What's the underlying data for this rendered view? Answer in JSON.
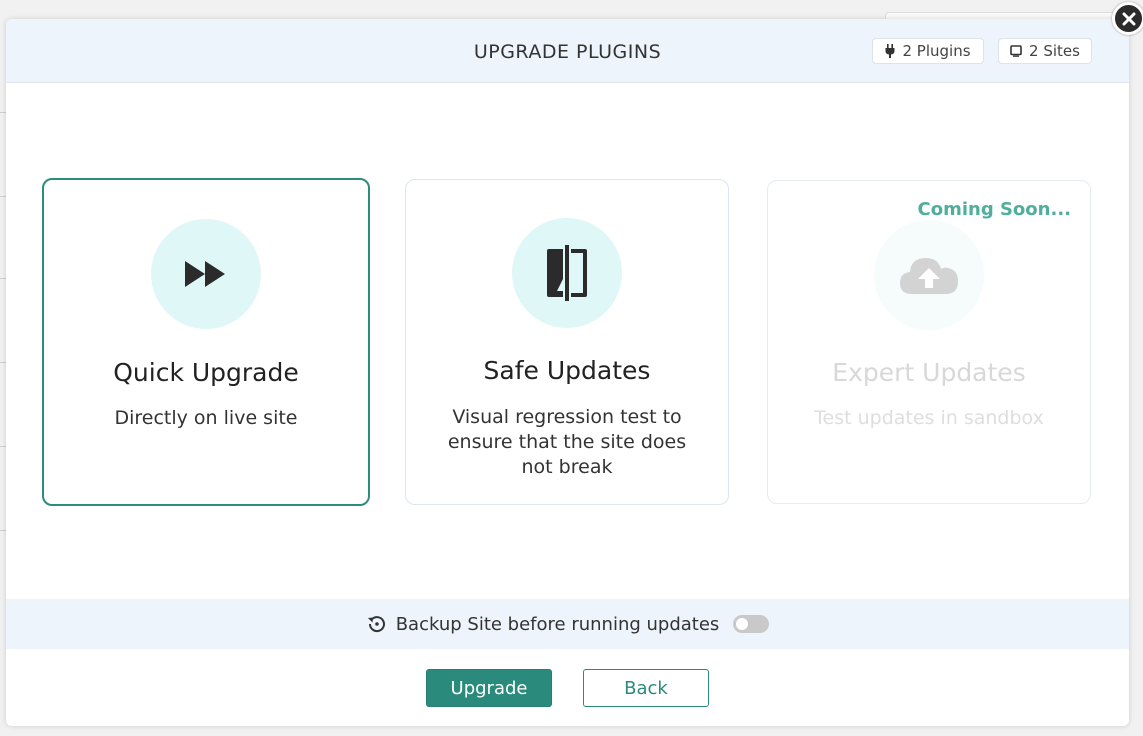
{
  "modal": {
    "title": "UPGRADE PLUGINS",
    "plugins_chip": "2 Plugins",
    "sites_chip": "2 Sites"
  },
  "options": [
    {
      "title": "Quick Upgrade",
      "description": "Directly on live site",
      "icon": "fast-forward-icon",
      "selected": true
    },
    {
      "title": "Safe Updates",
      "description": "Visual regression test to ensure that the site does not break",
      "icon": "compare-icon",
      "selected": false
    },
    {
      "title": "Expert Updates",
      "description": "Test updates in sandbox",
      "icon": "cloud-upload-icon",
      "badge": "Coming Soon...",
      "disabled": true
    }
  ],
  "backup": {
    "label": "Backup Site before running updates",
    "enabled": false
  },
  "buttons": {
    "upgrade": "Upgrade",
    "back": "Back"
  },
  "colors": {
    "accent": "#2a8a7b",
    "header_bg": "#eef4fb",
    "icon_bg": "#e0f7f8",
    "coming_soon": "#4fae9c"
  }
}
